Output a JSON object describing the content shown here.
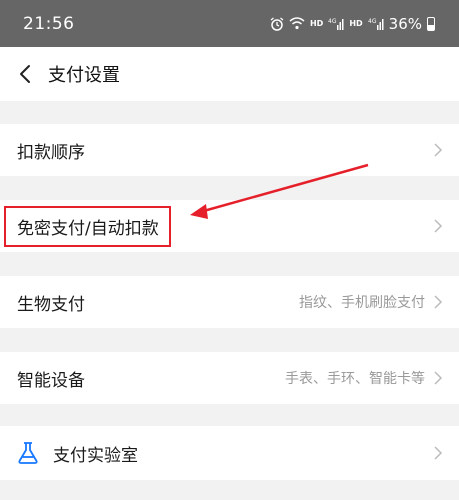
{
  "status_bar": {
    "time": "21:56",
    "network_1": "HD",
    "network_2": "HD",
    "signal_label": "4G",
    "battery": "36%"
  },
  "nav": {
    "title": "支付设置"
  },
  "settings": {
    "payment_order": {
      "label": "扣款顺序"
    },
    "auto_pay": {
      "label": "免密支付/自动扣款"
    },
    "biometric": {
      "label": "生物支付",
      "value": "指纹、手机刷脸支付"
    },
    "smart_devices": {
      "label": "智能设备",
      "value": "手表、手环、智能卡等"
    },
    "lab": {
      "label": "支付实验室"
    }
  },
  "colors": {
    "status_bar": "#666666",
    "annotation": "#e5202a",
    "lab_icon": "#1677ff"
  }
}
